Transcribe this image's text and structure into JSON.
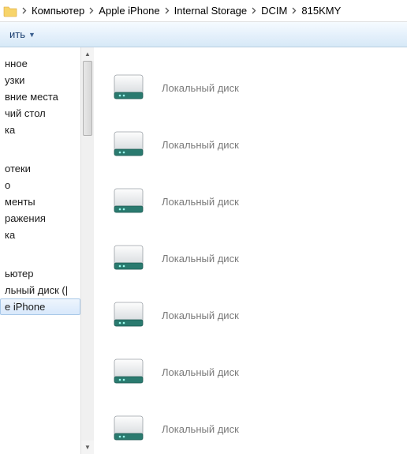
{
  "breadcrumb": {
    "items": [
      "Компьютер",
      "Apple iPhone",
      "Internal Storage",
      "DCIM",
      "815KMY"
    ]
  },
  "toolbar": {
    "button_label": "ить"
  },
  "sidebar": {
    "section1": [
      {
        "label": "нное"
      },
      {
        "label": "узки"
      },
      {
        "label": "вние места"
      },
      {
        "label": "чий стол"
      },
      {
        "label": "ка"
      }
    ],
    "section2": [
      {
        "label": "отеки"
      },
      {
        "label": "о"
      },
      {
        "label": "менты"
      },
      {
        "label": "ражения"
      },
      {
        "label": "ка"
      }
    ],
    "section3": [
      {
        "label": "ьютер"
      },
      {
        "label": "льный диск (|"
      },
      {
        "label": "e iPhone",
        "selected": true
      }
    ]
  },
  "content": {
    "items": [
      {
        "label": "Локальный диск"
      },
      {
        "label": "Локальный диск"
      },
      {
        "label": "Локальный диск"
      },
      {
        "label": "Локальный диск"
      },
      {
        "label": "Локальный диск"
      },
      {
        "label": "Локальный диск"
      },
      {
        "label": "Локальный диск"
      }
    ]
  }
}
